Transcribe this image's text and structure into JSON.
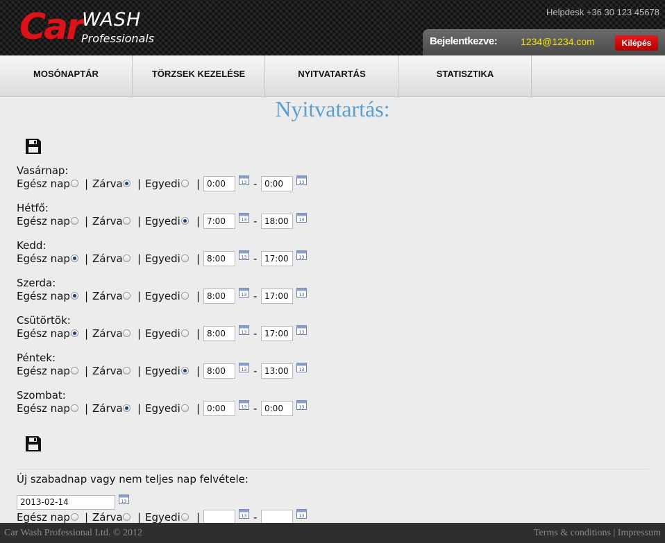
{
  "header": {
    "logo_car": "Car",
    "logo_wash": "WASH",
    "logo_professionals": "Professionals",
    "helpdesk": "Helpdesk +36 30 123 45678",
    "login_label": "Bejelentkezve:",
    "login_email": "1234@1234.com",
    "logout_label": "Kilépés"
  },
  "nav": {
    "items": [
      {
        "label": "MOSÓNAPTÁR"
      },
      {
        "label": "TÖRZSEK KEZELÉSE"
      },
      {
        "label": "NYITVATARTÁS"
      },
      {
        "label": "STATISZTIKA"
      }
    ]
  },
  "page": {
    "title": "Nyitvatartás:"
  },
  "options": {
    "full_day": "Egész nap",
    "closed": "Zárva",
    "custom": "Egyedi",
    "separator": "|",
    "dash": "-"
  },
  "days": [
    {
      "label": "Vasárnap:",
      "selected": "closed",
      "from": "0:00",
      "to": "0:00"
    },
    {
      "label": "Hétfő:",
      "selected": "custom",
      "from": "7:00",
      "to": "18:00"
    },
    {
      "label": "Kedd:",
      "selected": "full_day",
      "from": "8:00",
      "to": "17:00"
    },
    {
      "label": "Szerda:",
      "selected": "full_day",
      "from": "8:00",
      "to": "17:00"
    },
    {
      "label": "Csütörtök:",
      "selected": "full_day",
      "from": "8:00",
      "to": "17:00"
    },
    {
      "label": "Péntek:",
      "selected": "custom",
      "from": "8:00",
      "to": "13:00"
    },
    {
      "label": "Szombat:",
      "selected": "closed",
      "from": "0:00",
      "to": "0:00"
    }
  ],
  "new_holiday": {
    "title": "Új szabadnap vagy nem teljes nap felvétele:",
    "date": "2013-02-14",
    "selected": "none",
    "from": "",
    "to": ""
  },
  "footer": {
    "copyright": "Car Wash Professional Ltd. © 2012",
    "terms": "Terms & conditions",
    "separator": "|",
    "impressum": "Impressum"
  },
  "colors": {
    "brand_red": "#d9151b",
    "title_blue": "#5b9fd2",
    "email_yellow": "#f5e400"
  }
}
